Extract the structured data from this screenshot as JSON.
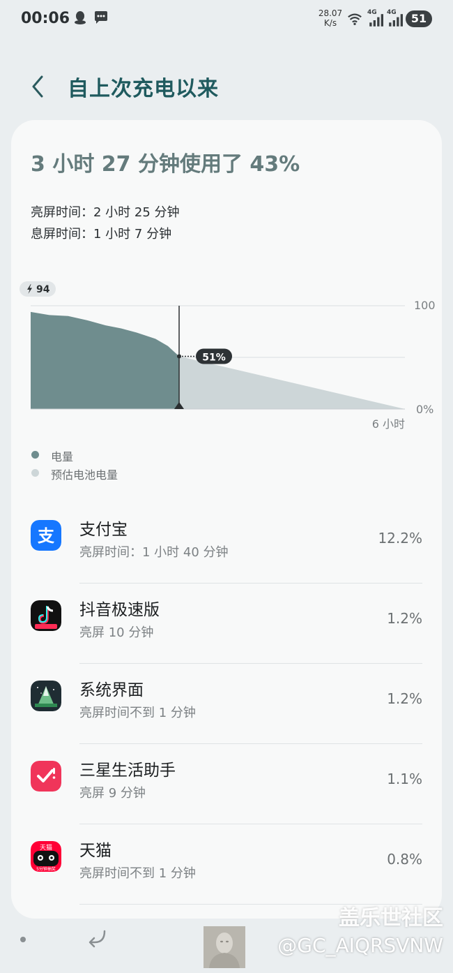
{
  "status_bar": {
    "time": "00:06",
    "speed_value": "28.07",
    "speed_unit": "K/s",
    "network_1": "4G",
    "network_2": "4G",
    "battery": "51"
  },
  "header": {
    "title": "自上次充电以来"
  },
  "summary": {
    "headline": "3 小时 27 分钟使用了 43%",
    "screen_on": "亮屏时间：2 小时 25 分钟",
    "screen_off": "息屏时间：1 小时 7 分钟"
  },
  "chart_data": {
    "type": "area",
    "start_label": "94",
    "y_ticks": [
      "100",
      "0%"
    ],
    "x_end_label": "6 小时",
    "current_label": "51%",
    "ylim": [
      0,
      100
    ],
    "xlim": [
      0,
      6
    ],
    "grid": true,
    "series": [
      {
        "name": "电量",
        "x": [
          0,
          0.3,
          0.6,
          0.9,
          1.2,
          1.45,
          1.7,
          2.0,
          2.2,
          2.38
        ],
        "values": [
          94,
          91,
          90,
          86,
          81,
          78,
          74,
          68,
          61,
          51
        ]
      },
      {
        "name": "预估电池电量",
        "x": [
          2.38,
          6
        ],
        "values": [
          51,
          0
        ]
      }
    ],
    "legend_position": "bottom-left",
    "colors": {
      "actual": "#6f8d8e",
      "estimated": "#cdd6d8"
    }
  },
  "legend": {
    "actual": "电量",
    "estimated": "预估电池电量"
  },
  "apps": [
    {
      "name": "支付宝",
      "detail": "亮屏时间：1 小时 40 分钟",
      "percent": "12.2%",
      "icon": "alipay-icon"
    },
    {
      "name": "抖音极速版",
      "detail": "亮屏 10 分钟",
      "percent": "1.2%",
      "icon": "douyin-lite-icon"
    },
    {
      "name": "系统界面",
      "detail": "亮屏时间不到 1 分钟",
      "percent": "1.2%",
      "icon": "system-ui-icon"
    },
    {
      "name": "三星生活助手",
      "detail": "亮屏 9 分钟",
      "percent": "1.1%",
      "icon": "samsung-reminder-icon"
    },
    {
      "name": "天猫",
      "detail": "亮屏时间不到 1 分钟",
      "percent": "0.8%",
      "icon": "tmall-icon",
      "icon_text_top": "天猫",
      "icon_text_bottom": "5分钟抽奖"
    }
  ],
  "watermark": {
    "brand": "盖乐世社区",
    "handle": "@GC_AIQRSVNW"
  }
}
